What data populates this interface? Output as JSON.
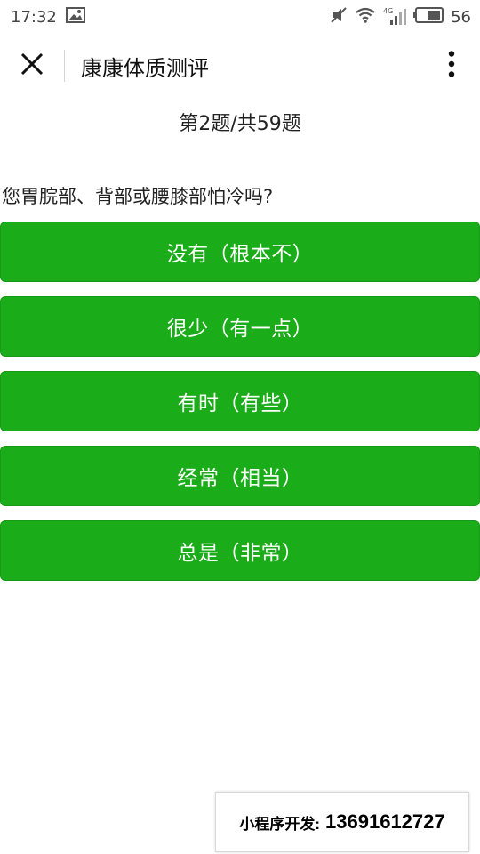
{
  "status_bar": {
    "time": "17:32",
    "battery_level": "56",
    "network_label": "4G",
    "icons": [
      "image-icon",
      "mute-icon",
      "wifi-icon",
      "signal-icon",
      "battery-icon"
    ]
  },
  "nav": {
    "title": "康康体质测评",
    "close_icon": "close-icon",
    "more_icon": "more-vertical-icon"
  },
  "quiz": {
    "counter": "第2题/共59题",
    "question": "您胃脘部、背部或腰膝部怕冷吗?",
    "options": [
      "没有（根本不）",
      "很少（有一点）",
      "有时（有些）",
      "经常（相当）",
      "总是（非常）"
    ]
  },
  "footer": {
    "label": "小程序开发:",
    "phone": "13691612727"
  },
  "colors": {
    "accent": "#1aad19",
    "text": "#222222",
    "background": "#ffffff"
  }
}
